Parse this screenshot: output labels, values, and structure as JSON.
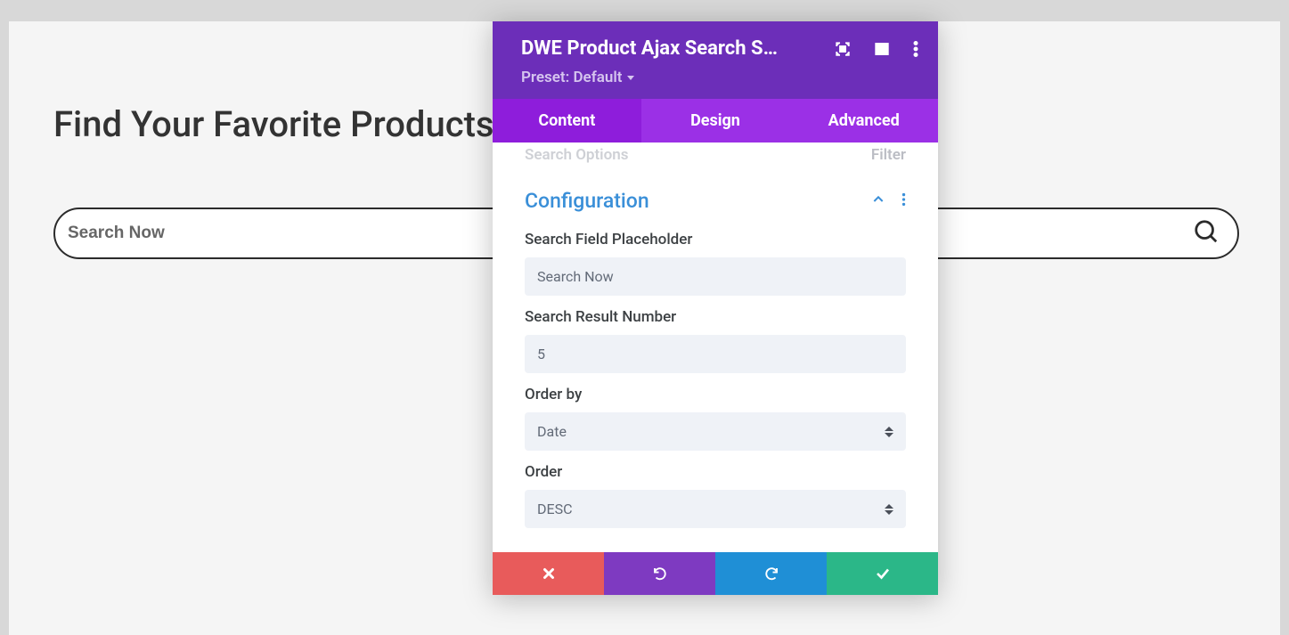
{
  "page": {
    "title": "Find Your Favorite Products"
  },
  "search": {
    "placeholder": "Search Now"
  },
  "panel": {
    "title": "DWE Product Ajax Search S…",
    "preset_label": "Preset: Default",
    "tabs": {
      "content": "Content",
      "design": "Design",
      "advanced": "Advanced"
    },
    "filter_row": {
      "left": "Search Options",
      "right": "Filter"
    },
    "section_title": "Configuration",
    "fields": {
      "placeholder_label": "Search Field Placeholder",
      "placeholder_value": "Search Now",
      "result_number_label": "Search Result Number",
      "result_number_value": "5",
      "orderby_label": "Order by",
      "orderby_value": "Date",
      "order_label": "Order",
      "order_value": "DESC"
    }
  }
}
